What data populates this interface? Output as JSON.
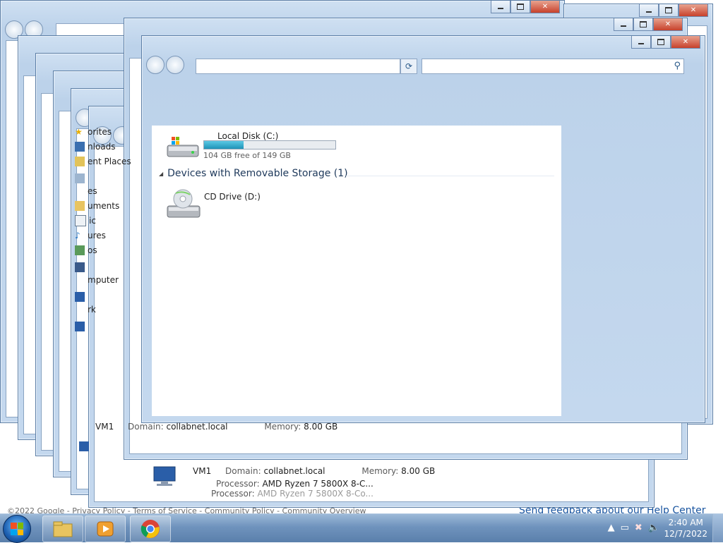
{
  "web_footer": {
    "left": "©2022 Google - Privacy Policy - Terms of Service - Community Policy - Community Overview",
    "right": "Send feedback about our Help Center"
  },
  "sidebar_items": [
    {
      "label": "orites",
      "icon": "star-icon"
    },
    {
      "label": "nloads",
      "icon": "downloads-icon"
    },
    {
      "label": "ent Places",
      "icon": "recent-places-icon"
    },
    {
      "label": "",
      "icon": "libraries-icon"
    },
    {
      "label": "es",
      "icon": "libraries-label"
    },
    {
      "label": "uments",
      "icon": "documents-icon"
    },
    {
      "label": "ic",
      "icon": "music-icon"
    },
    {
      "label": "ures",
      "icon": "pictures-icon"
    },
    {
      "label": "os",
      "icon": "videos-icon"
    },
    {
      "label": "mputer",
      "icon": "computer-icon"
    },
    {
      "label": "",
      "icon": "network-icon"
    },
    {
      "label": "rk",
      "icon": "network-label"
    }
  ],
  "drives": {
    "local_disk": {
      "label": "Local Disk (C:)",
      "free_text": "104 GB free of 149 GB",
      "used_fraction": 0.3
    },
    "group_header": "Devices with Removable Storage (1)",
    "cd_drive": {
      "label": "CD Drive (D:)"
    }
  },
  "details_a": {
    "name": "VM1",
    "domain_label": "Domain:",
    "domain_value": "collabnet.local",
    "memory_label": "Memory:",
    "memory_value": "8.00 GB"
  },
  "details_b": {
    "name": "VM1",
    "domain_label": "Domain:",
    "domain_value": "collabnet.local",
    "memory_label": "Memory:",
    "memory_value": "8.00 GB"
  },
  "details_c": {
    "processor_label": "Processor:",
    "processor_value": "AMD Ryzen 7 5800X 8-C..."
  },
  "details_d": {
    "processor_label": "Processor:",
    "processor_value": "AMD Ryzen 7 5800X 8-Co..."
  },
  "clock": {
    "time": "2:40 AM",
    "date": "12/7/2022"
  },
  "taskbar": {
    "items": [
      {
        "name": "windows-explorer-taskbar-button",
        "icon": "folder-icon"
      },
      {
        "name": "media-player-taskbar-button",
        "icon": "media-player-icon"
      },
      {
        "name": "chrome-taskbar-button",
        "icon": "chrome-icon"
      }
    ]
  },
  "colors": {
    "accent": "#1e395b",
    "bar_fill": "#26a0c6",
    "taskbar": "#6f93bd",
    "close_button": "#c7412c"
  }
}
